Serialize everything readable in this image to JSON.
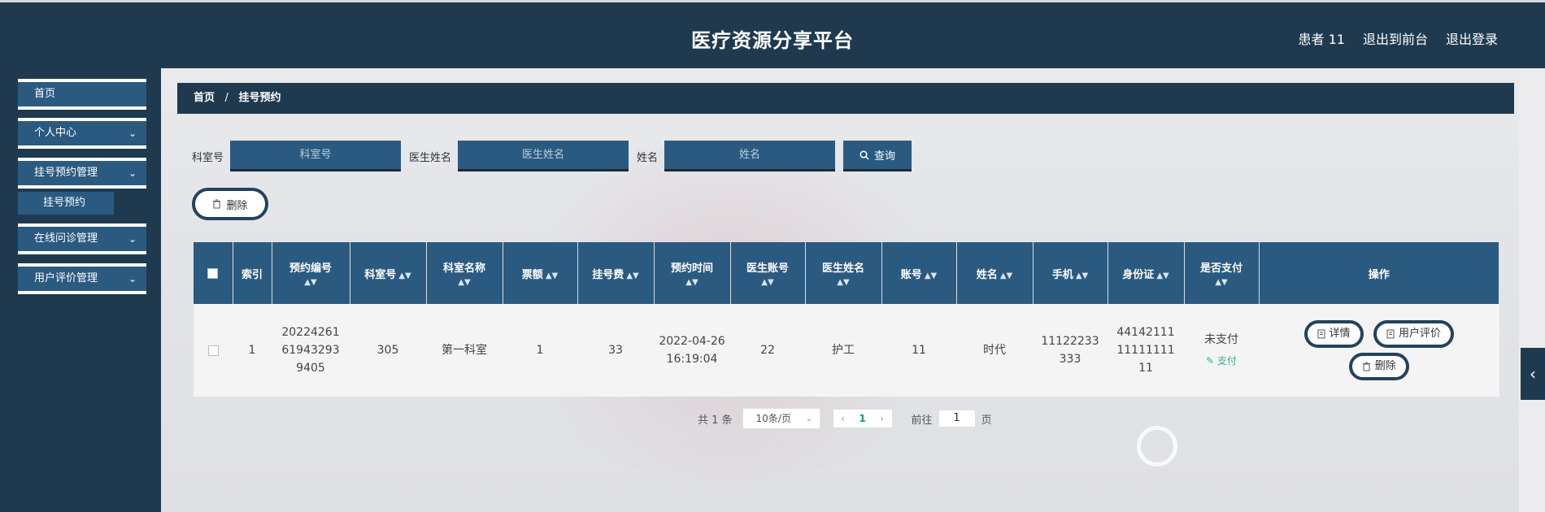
{
  "header": {
    "title": "医疗资源分享平台",
    "user": "患者 11",
    "back_front": "退出到前台",
    "logout": "退出登录"
  },
  "sidebar": {
    "items": [
      {
        "label": "首页"
      },
      {
        "label": "个人中心"
      },
      {
        "label": "挂号预约管理"
      },
      {
        "label": "挂号预约"
      },
      {
        "label": "在线问诊管理"
      },
      {
        "label": "用户评价管理"
      }
    ],
    "chevron": "chevron-down-icon"
  },
  "breadcrumb": {
    "home": "首页",
    "sep": "/",
    "current": "挂号预约"
  },
  "search": {
    "dept_label": "科室号",
    "dept_placeholder": "科室号",
    "doctor_label": "医生姓名",
    "doctor_placeholder": "医生姓名",
    "name_label": "姓名",
    "name_placeholder": "姓名",
    "button": "查询"
  },
  "actions": {
    "delete": "删除"
  },
  "table": {
    "headers": [
      "索引",
      "预约编号",
      "科室号",
      "科室名称",
      "票额",
      "挂号费",
      "预约时间",
      "医生账号",
      "医生姓名",
      "账号",
      "姓名",
      "手机",
      "身份证",
      "是否支付",
      "操作"
    ],
    "rows": [
      {
        "index": "1",
        "booking_no": "20224261619432939405",
        "dept_no": "305",
        "dept_name": "第一科室",
        "quota": "1",
        "fee": "33",
        "time": "2022-04-26 16:19:04",
        "doctor_account": "22",
        "doctor_name": "护工",
        "account": "11",
        "name": "时代",
        "phone": "11122233333",
        "id_card": "441421111111111111",
        "paid": "未支付",
        "pay_link": "支付"
      }
    ],
    "ops": {
      "detail": "详情",
      "review": "用户评价",
      "delete": "删除"
    }
  },
  "pagination": {
    "total": "共 1 条",
    "page_size": "10条/页",
    "current_page": "1",
    "goto_label": "前往",
    "goto_value": "1",
    "page_suffix": "页"
  },
  "colors": {
    "navy": "#1f3a4f",
    "blue": "#2b5a80",
    "paid_green": "#2fb87c"
  }
}
